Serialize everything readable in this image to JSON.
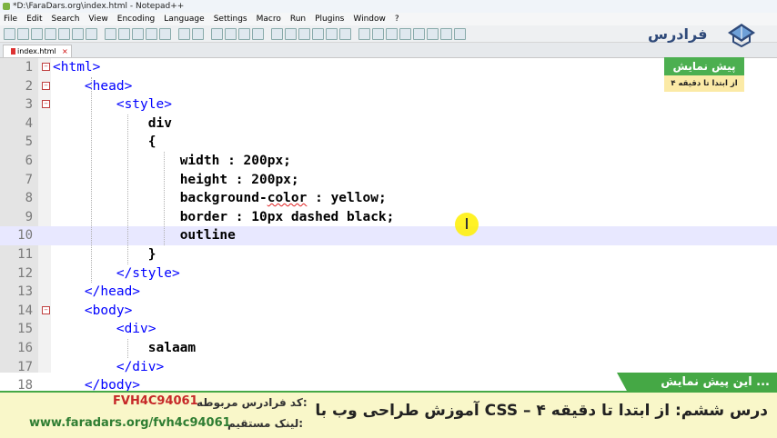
{
  "window": {
    "title": "*D:\\FaraDars.org\\index.html - Notepad++"
  },
  "menu": [
    "File",
    "Edit",
    "Search",
    "View",
    "Encoding",
    "Language",
    "Settings",
    "Macro",
    "Run",
    "Plugins",
    "Window",
    "?"
  ],
  "tab": {
    "label": "index.html"
  },
  "editor": {
    "current_line": 10,
    "lines": [
      {
        "n": "1",
        "html": "<span class=\"tag\">&lt;html&gt;</span>"
      },
      {
        "n": "2",
        "html": "    <span class=\"tag\">&lt;head&gt;</span>"
      },
      {
        "n": "3",
        "html": "        <span class=\"tag\">&lt;style&gt;</span>"
      },
      {
        "n": "4",
        "html": "            <span class=\"sel\">div</span>"
      },
      {
        "n": "5",
        "html": "            <span class=\"txt\">{</span>"
      },
      {
        "n": "6",
        "html": "                <span class=\"prop\">width : 200px;</span>"
      },
      {
        "n": "7",
        "html": "                <span class=\"prop\">height : 200px;</span>"
      },
      {
        "n": "8",
        "html": "                <span class=\"prop\">background-<span class=\"squig\">color</span> : yellow;</span>"
      },
      {
        "n": "9",
        "html": "                <span class=\"prop\">border : 10px dashed black;</span>"
      },
      {
        "n": "10",
        "html": "                <span class=\"prop\">outline</span>"
      },
      {
        "n": "11",
        "html": "            <span class=\"txt\">}</span>"
      },
      {
        "n": "12",
        "html": "        <span class=\"tag\">&lt;/style&gt;</span>"
      },
      {
        "n": "13",
        "html": "    <span class=\"tag\">&lt;/head&gt;</span>"
      },
      {
        "n": "14",
        "html": "    <span class=\"tag\">&lt;body&gt;</span>"
      },
      {
        "n": "15",
        "html": "        <span class=\"tag\">&lt;div&gt;</span>"
      },
      {
        "n": "16",
        "html": "            <span class=\"txt\">salaam</span>"
      },
      {
        "n": "17",
        "html": "        <span class=\"tag\">&lt;/div&gt;</span>"
      },
      {
        "n": "18",
        "html": "    <span class=\"tag\">&lt;/body&gt;</span>"
      }
    ],
    "folds": [
      "1",
      "2",
      "3",
      "14"
    ]
  },
  "logo": {
    "text": "فرادرس"
  },
  "preview": {
    "title": "پیش نمایش",
    "subtitle": "از ابتدا تا دقیقه ۴"
  },
  "ribbon": {
    "text": "این پیش نمایش ..."
  },
  "footer": {
    "course_title": "آموزش طراحی وب با CSS – درس ششم: از ابتدا تا دقیقه ۴",
    "code_label": "کد فرادرس مربوطه:",
    "code_value": "FVH4C94061",
    "link_label": "لینک مستقیم:",
    "link_value": "www.faradars.org/fvh4c94061"
  },
  "colors": {
    "tag": "#0000ff",
    "brand_green": "#45a845",
    "footer_bg": "#f9f7c9",
    "code_red": "#c62828"
  }
}
